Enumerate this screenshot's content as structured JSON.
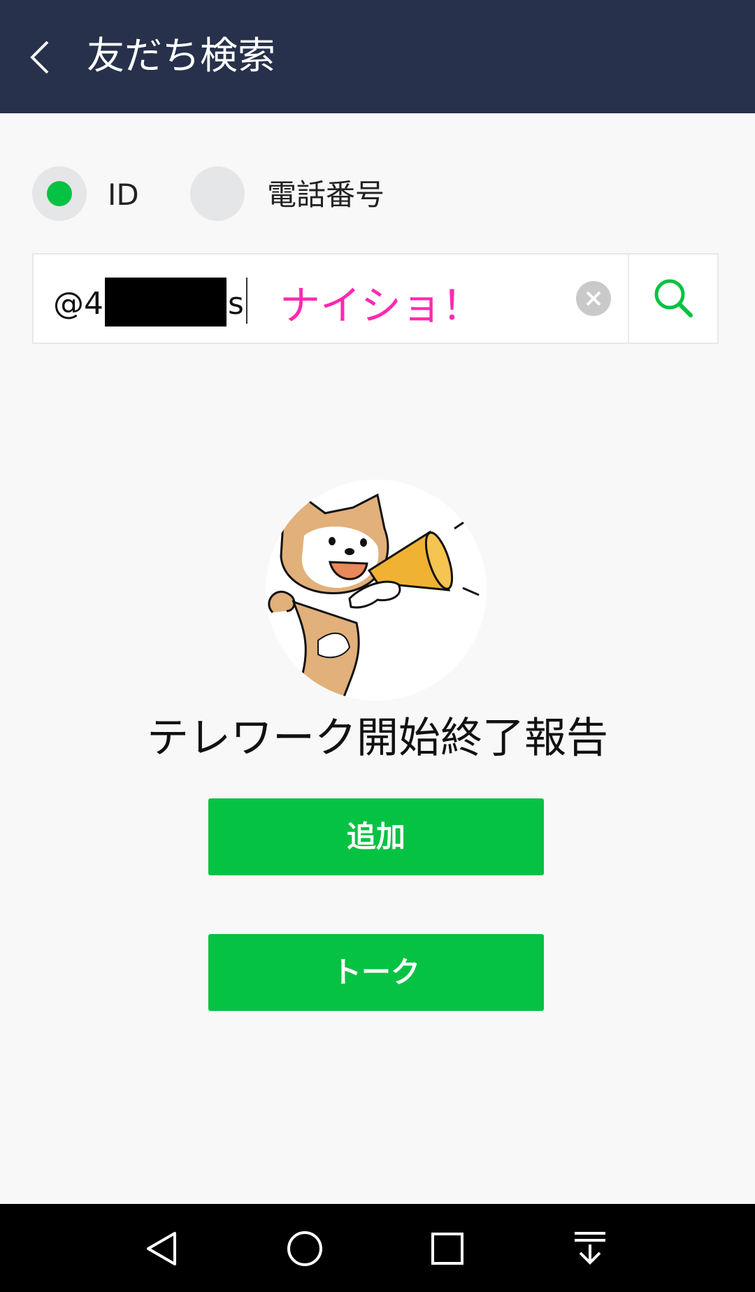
{
  "header": {
    "title": "友だち検索",
    "background": "#27314b"
  },
  "search_type": {
    "options": [
      {
        "label": "ID",
        "selected": true
      },
      {
        "label": "電話番号",
        "selected": false
      }
    ],
    "accent": "#06c243"
  },
  "search": {
    "value_prefix": "@4",
    "value_suffix": "s",
    "overlay_text": "ナイショ！",
    "overlay_color": "#ff29b0"
  },
  "result": {
    "avatar_icon": "shiba-dog-megaphone-icon",
    "name": "テレワーク開始終了報告",
    "add_label": "追加",
    "talk_label": "トーク",
    "button_color": "#06c243"
  },
  "navbar": {
    "icons": [
      "back-triangle-icon",
      "home-circle-icon",
      "recents-square-icon",
      "notification-pull-down-icon"
    ]
  }
}
